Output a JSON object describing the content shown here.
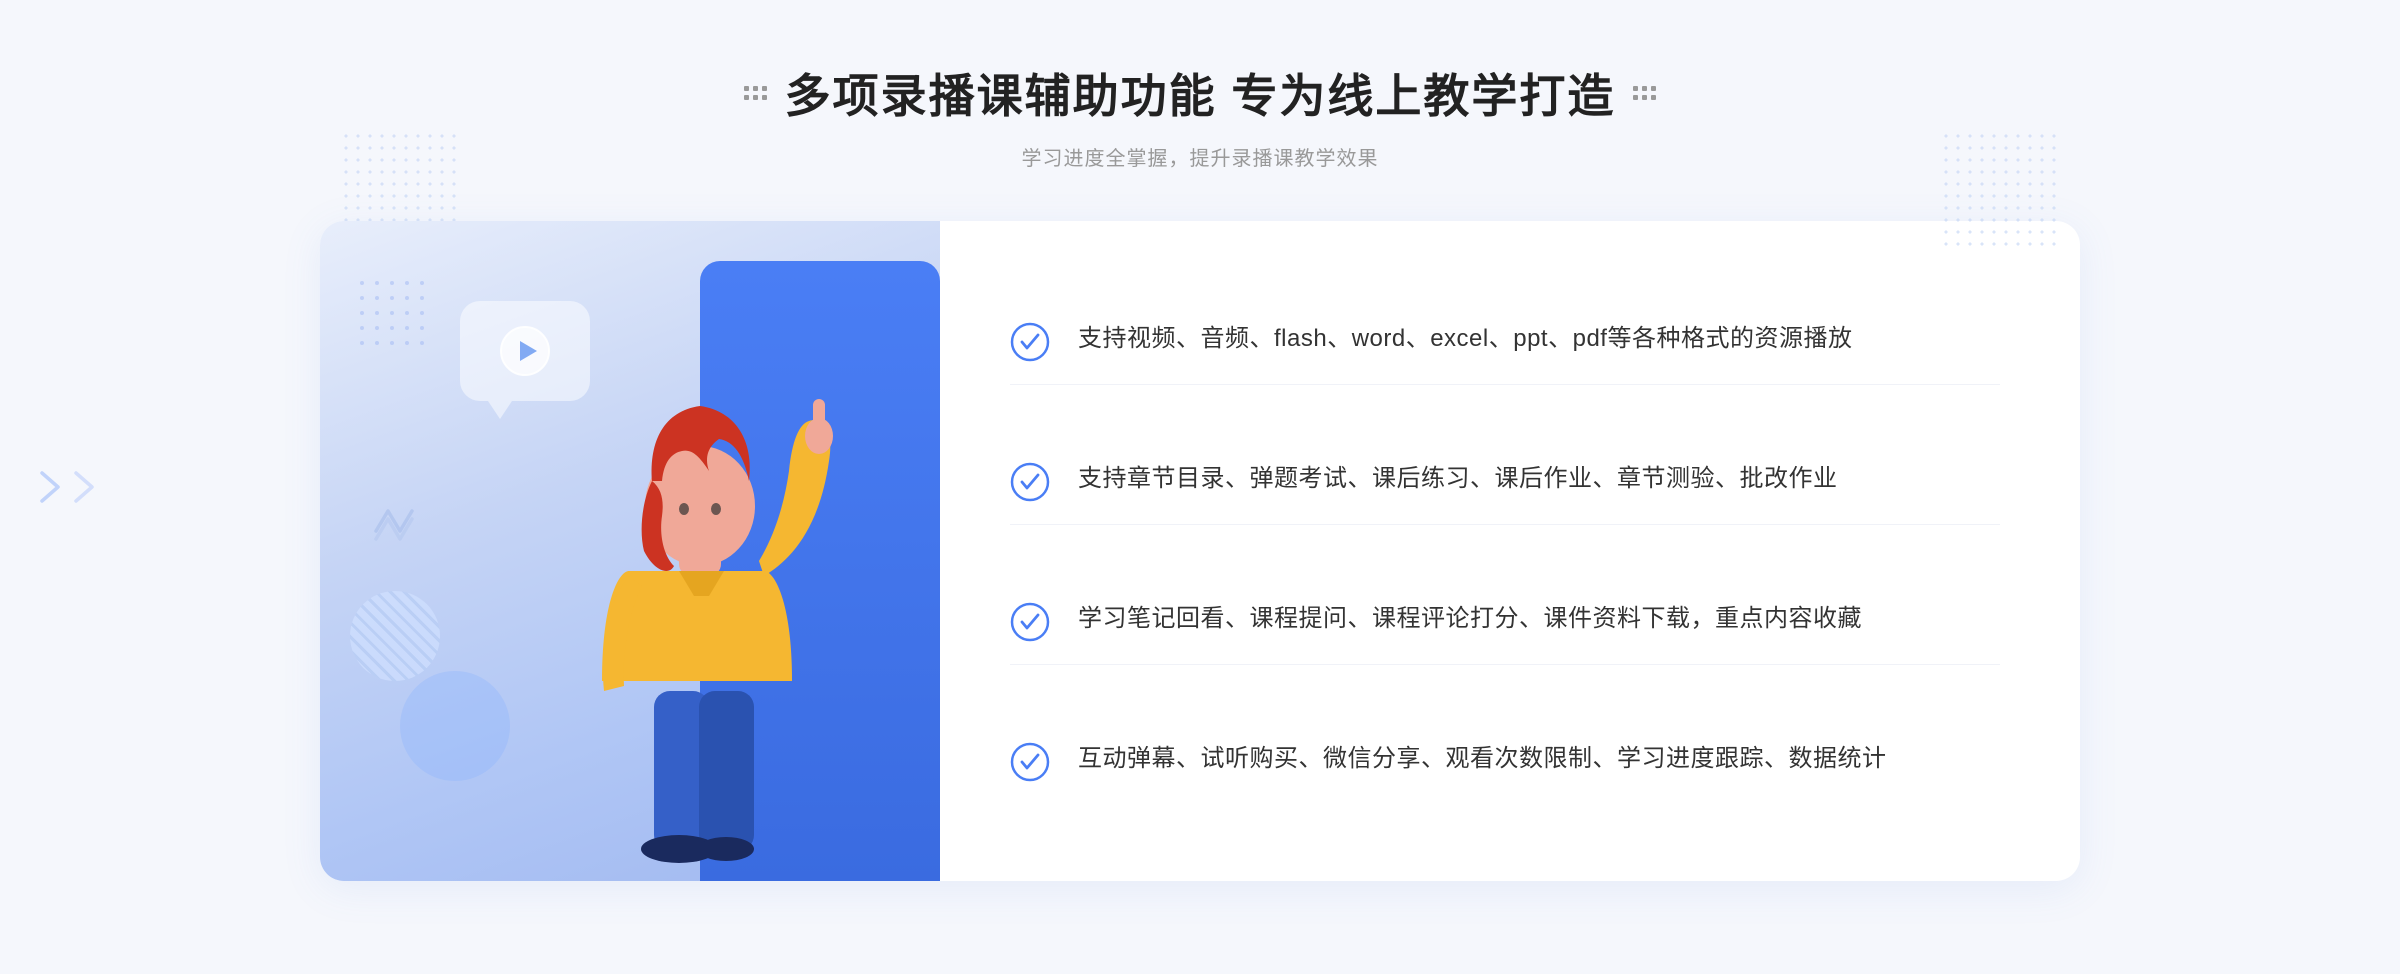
{
  "header": {
    "title": "多项录播课辅助功能 专为线上教学打造",
    "subtitle": "学习进度全掌握，提升录播课教学效果"
  },
  "features": [
    {
      "id": "feature-1",
      "text": "支持视频、音频、flash、word、excel、ppt、pdf等各种格式的资源播放"
    },
    {
      "id": "feature-2",
      "text": "支持章节目录、弹题考试、课后练习、课后作业、章节测验、批改作业"
    },
    {
      "id": "feature-3",
      "text": "学习笔记回看、课程提问、课程评论打分、课件资料下载，重点内容收藏"
    },
    {
      "id": "feature-4",
      "text": "互动弹幕、试听购买、微信分享、观看次数限制、学习进度跟踪、数据统计"
    }
  ],
  "icons": {
    "check": "check-circle-icon",
    "play": "play-icon",
    "left_arrow": "left-chevron-icon"
  },
  "colors": {
    "primary": "#4a7ef5",
    "primary_dark": "#3a6be0",
    "text_dark": "#222222",
    "text_medium": "#333333",
    "text_light": "#999999",
    "bg": "#f5f7fc",
    "card_bg": "#ffffff",
    "illus_bg_start": "#e8eefb",
    "illus_bg_end": "#a0b8f0"
  }
}
